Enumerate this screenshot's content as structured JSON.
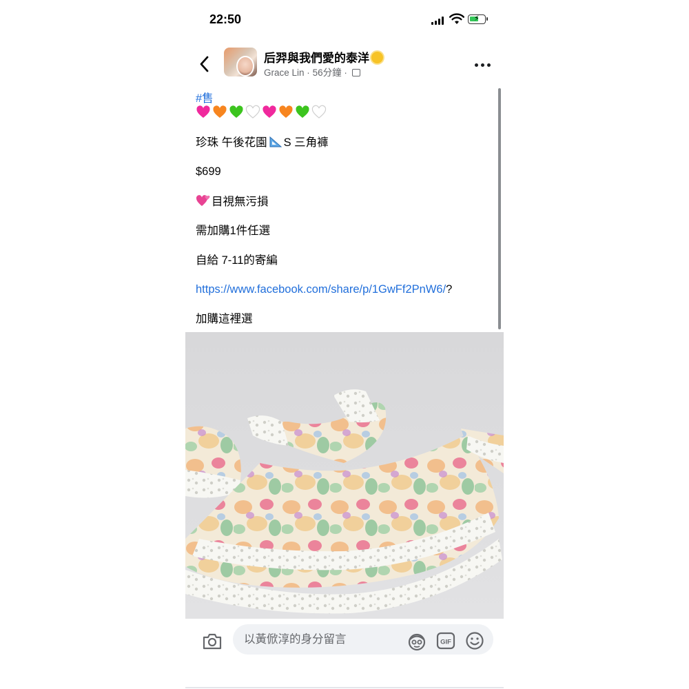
{
  "status_bar": {
    "time": "22:50"
  },
  "header": {
    "back_icon": "chevron-left-icon",
    "group_name": "后羿與我們愛的泰洋",
    "group_emoji": "sun-face-emoji",
    "author": "Grace Lin",
    "separator": "·",
    "time_ago": "56分鐘",
    "more_icon": "more-horizontal-icon"
  },
  "post": {
    "hashtag": "#售",
    "hearts": [
      "pink-heart",
      "orange-heart",
      "green-heart",
      "white-heart",
      "pink-heart",
      "orange-heart",
      "green-heart",
      "white-heart"
    ],
    "title_before": "珍珠 午後花園",
    "title_after": "S 三角褲",
    "price": "$699",
    "condition": "目視無污損",
    "requirement": "需加購1件任選",
    "shipping": "自給 7-11的寄編",
    "link": "https://www.facebook.com/share/p/1GwFf2PnW6/",
    "link_suffix": "?",
    "addon": "加購這裡選"
  },
  "photo": {
    "subject": "floral-baby-dress-photo"
  },
  "comment_bar": {
    "placeholder": "以黃俽淳的身分留言",
    "camera_icon": "camera-icon",
    "sticker_icon": "avatar-sticker-icon",
    "gif_label": "GIF",
    "emoji_icon": "smiley-icon"
  },
  "colors": {
    "link": "#216fdb",
    "text": "#050505",
    "muted": "#65676b",
    "input_bg": "#f0f2f5",
    "battery": "#34c759"
  }
}
